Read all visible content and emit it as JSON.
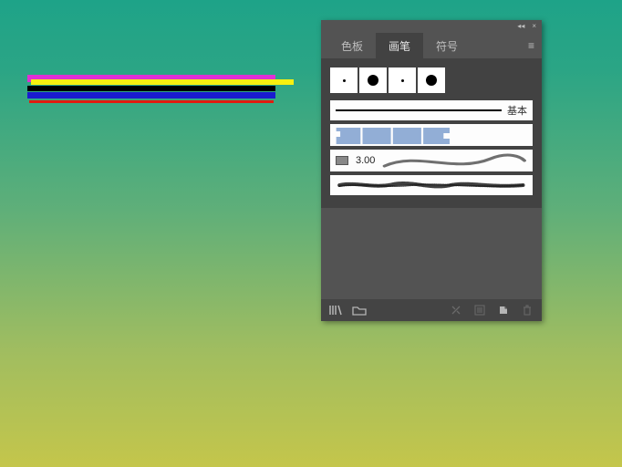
{
  "tabs": {
    "swatches": "色板",
    "brushes": "画笔",
    "symbols": "符号"
  },
  "panel": {
    "basic_label": "基本",
    "stroke_weight": "3.00"
  },
  "icons": {
    "collapse": "◂◂",
    "close": "×",
    "menu": "≡",
    "library": "library",
    "folder": "folder",
    "break": "break",
    "options": "options",
    "new": "new",
    "trash": "trash"
  }
}
